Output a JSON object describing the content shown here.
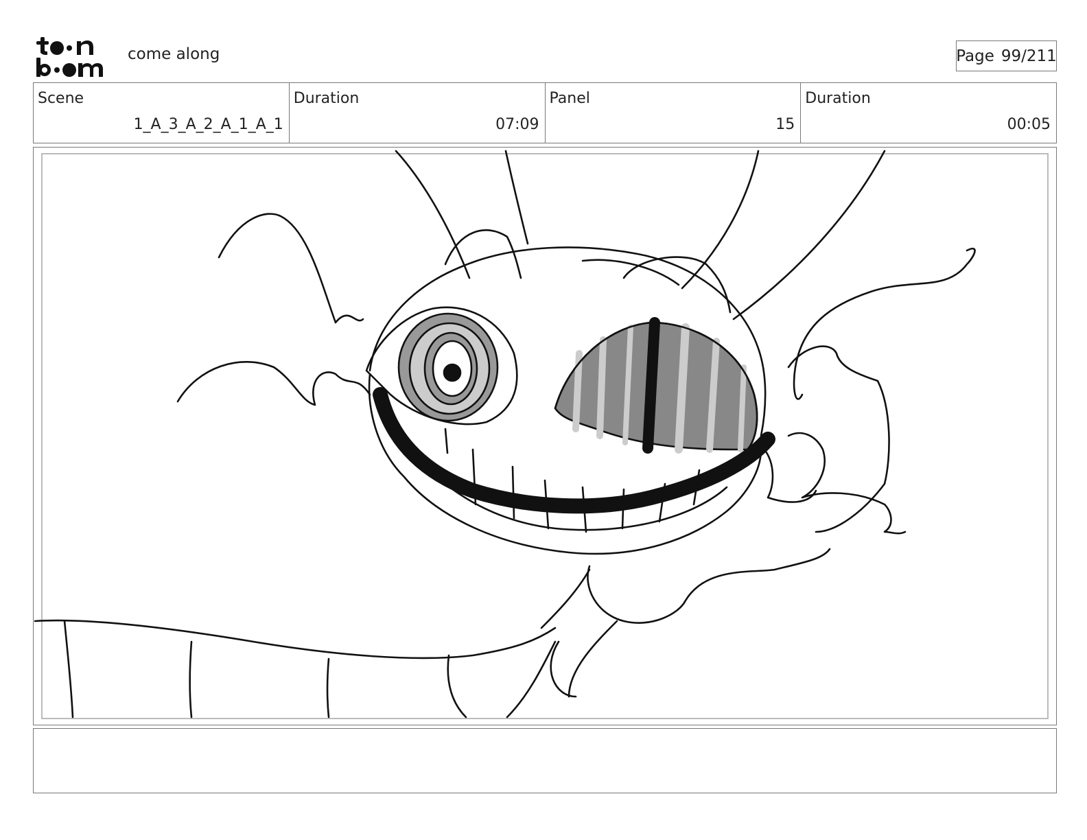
{
  "header": {
    "logo_top": "t••n",
    "logo_bottom": "b••m",
    "project_title": "come along",
    "page_label": "Page",
    "page_value": "99/211"
  },
  "info": {
    "scene_label": "Scene",
    "scene_value": "1_A_3_A_2_A_1_A_1",
    "duration_label": "Duration",
    "duration_value": "07:09",
    "panel_label": "Panel",
    "panel_value": "15",
    "panel_duration_label": "Duration",
    "panel_duration_value": "00:05"
  },
  "notes": {
    "text": ""
  }
}
